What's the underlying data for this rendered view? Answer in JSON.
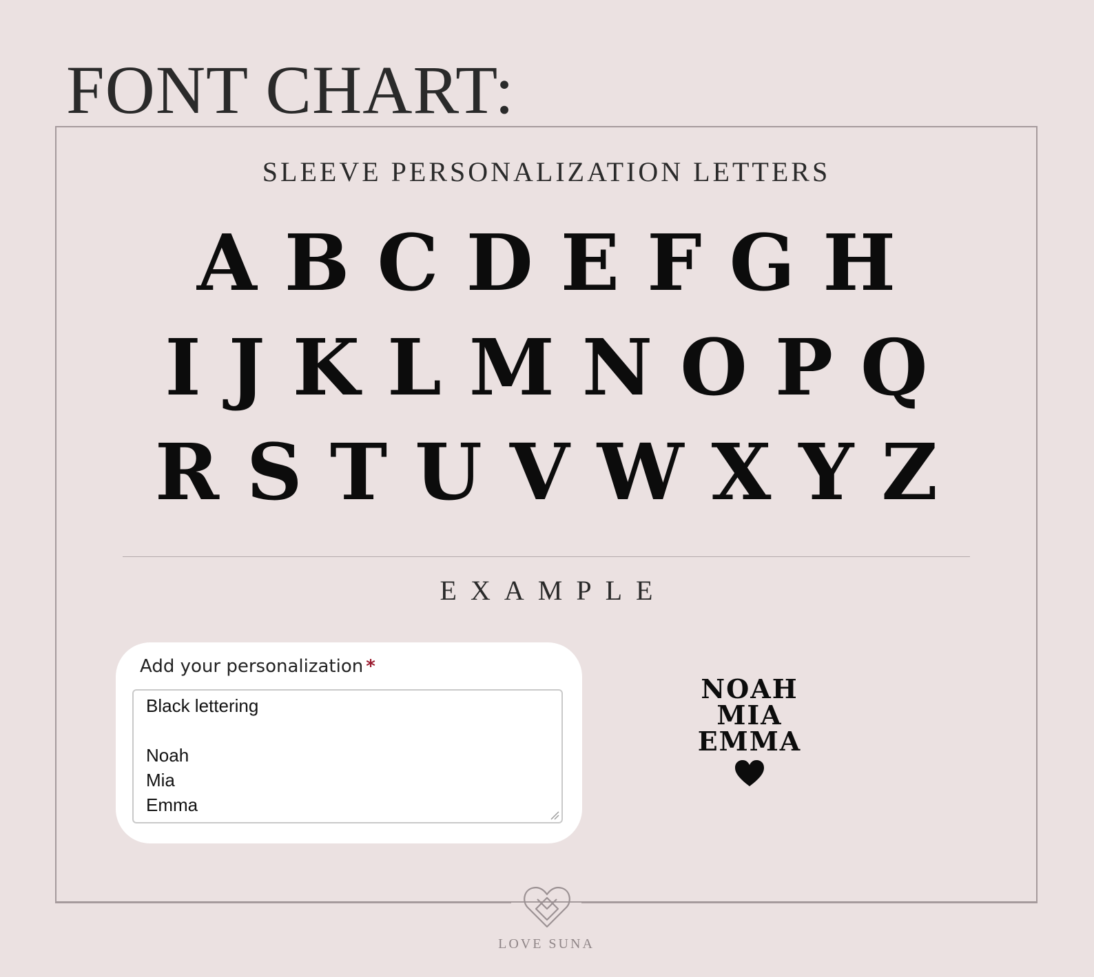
{
  "title": "FONT CHART:",
  "sleeve_title": "SLEEVE PERSONALIZATION LETTERS",
  "alphabet": {
    "row1": [
      "A",
      "B",
      "C",
      "D",
      "E",
      "F",
      "G",
      "H"
    ],
    "row2": [
      "I",
      "J",
      "K",
      "L",
      "M",
      "N",
      "O",
      "P",
      "Q"
    ],
    "row3": [
      "R",
      "S",
      "T",
      "U",
      "V",
      "W",
      "X",
      "Y",
      "Z"
    ]
  },
  "example_title": "EXAMPLE",
  "form": {
    "label": "Add your personalization",
    "required_mark": "*",
    "value_lines": [
      "Black lettering",
      "",
      "Noah",
      "Mia",
      "Emma"
    ]
  },
  "preview": {
    "names": [
      "NOAH",
      "MIA",
      "EMMA"
    ],
    "icon": "heart-icon"
  },
  "footer": {
    "logo_icon": "love-suna-heart-logo",
    "brand": "LOVE SUNA"
  },
  "colors": {
    "background": "#ebe1e1",
    "frame": "#a59a9c",
    "required": "#9b1b2f",
    "letters": "#0c0c0c"
  }
}
